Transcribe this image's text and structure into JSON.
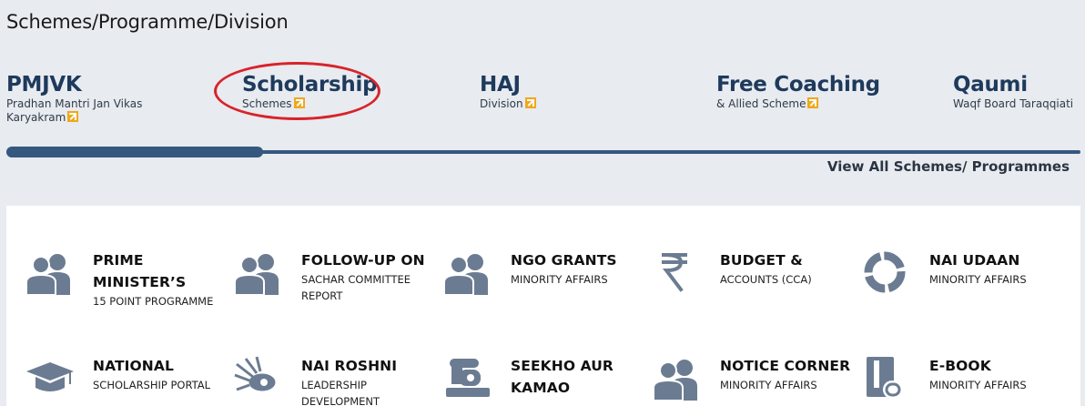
{
  "page": {
    "title": "Schemes/Programme/Division"
  },
  "schemes": [
    {
      "title": "PMJVK",
      "sub": "Pradhan Mantri Jan Vikas Karyakram",
      "icon": "external-link-icon"
    },
    {
      "title": "Scholarship",
      "sub": "Schemes",
      "icon": "external-link-icon"
    },
    {
      "title": "HAJ",
      "sub": "Division",
      "icon": "external-link-icon"
    },
    {
      "title": "Free Coaching",
      "sub": "& Allied Scheme",
      "icon": "external-link-icon"
    },
    {
      "title": "Qaumi",
      "sub": "Waqf Board Taraqqiati",
      "icon": ""
    }
  ],
  "carousel": {
    "view_all_label": "View All Schemes/ Programmes"
  },
  "tiles": [
    {
      "title": "PRIME MINISTER’S",
      "sub": "15 POINT PROGRAMME",
      "icon": "people-icon"
    },
    {
      "title": "FOLLOW-UP ON",
      "sub": "SACHAR COMMITTEE REPORT",
      "icon": "people-icon"
    },
    {
      "title": "NGO GRANTS",
      "sub": "MINORITY AFFAIRS",
      "icon": "people-icon"
    },
    {
      "title": "BUDGET &",
      "sub": "ACCOUNTS (CCA)",
      "icon": "rupee-icon"
    },
    {
      "title": "NAI UDAAN",
      "sub": "MINORITY AFFAIRS",
      "icon": "ring-icon"
    },
    {
      "title": "NATIONAL",
      "sub": "SCHOLARSHIP PORTAL",
      "icon": "graduation-cap-icon"
    },
    {
      "title": "NAI ROSHNI",
      "sub": "LEADERSHIP DEVELOPMENT",
      "icon": "eye-rays-icon"
    },
    {
      "title": "SEEKHO AUR KAMAO",
      "sub": "",
      "icon": "sewing-machine-icon"
    },
    {
      "title": "NOTICE CORNER",
      "sub": "MINORITY AFFAIRS",
      "icon": "people-icon"
    },
    {
      "title": "E-BOOK",
      "sub": "MINORITY AFFAIRS",
      "icon": "ebook-icon"
    }
  ],
  "colors": {
    "background": "#e8ebf0",
    "brand": "#1e3a5c",
    "track": "#35587f",
    "highlight": "#d8232a",
    "icon": "#6b7c92",
    "accent": "#f0a81a"
  }
}
